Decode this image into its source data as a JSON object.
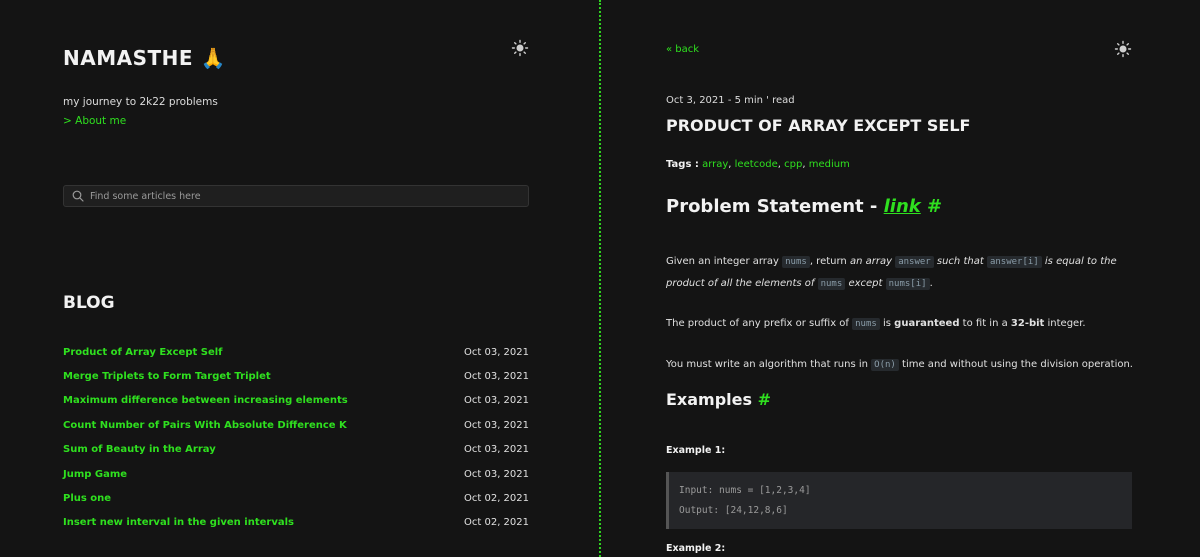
{
  "left": {
    "site_title": "NAMASTHE 🙏",
    "tagline": "my journey to 2k22 problems",
    "about_link": "> About me",
    "search": {
      "placeholder": "Find some articles here"
    },
    "blog_heading": "BLOG",
    "posts": [
      {
        "title": "Product of Array Except Self",
        "date": "Oct 03, 2021"
      },
      {
        "title": "Merge Triplets to Form Target Triplet",
        "date": "Oct 03, 2021"
      },
      {
        "title": "Maximum difference between increasing elements",
        "date": "Oct 03, 2021"
      },
      {
        "title": "Count Number of Pairs With Absolute Difference K",
        "date": "Oct 03, 2021"
      },
      {
        "title": "Sum of Beauty in the Array",
        "date": "Oct 03, 2021"
      },
      {
        "title": "Jump Game",
        "date": "Oct 03, 2021"
      },
      {
        "title": "Plus one",
        "date": "Oct 02, 2021"
      },
      {
        "title": "Insert new interval in the given intervals",
        "date": "Oct 02, 2021"
      }
    ]
  },
  "right": {
    "back": "« back",
    "meta": "Oct 3, 2021 - 5 min ' read",
    "title": "PRODUCT OF ARRAY EXCEPT SELF",
    "tags_label": "Tags :",
    "tags": [
      "array",
      "leetcode",
      "cpp",
      "medium"
    ],
    "problem_heading": "Problem Statement - ",
    "problem_link": "link",
    "hash": "#",
    "p1": {
      "t1": "Given an integer array ",
      "c1": "nums",
      "t2": ", return ",
      "i1": "an array ",
      "c2": "answer",
      "i2": " such that ",
      "c3": "answer[i]",
      "i3": " is equal to the product of all the elements of ",
      "c4": "nums",
      "i4": " except ",
      "c5": "nums[i]",
      "t3": "."
    },
    "p2": {
      "t1": "The product of any prefix or suffix of ",
      "c1": "nums",
      "t2": " is ",
      "b1": "guaranteed",
      "t3": " to fit in a ",
      "b2": "32-bit",
      "t4": " integer."
    },
    "p3": {
      "t1": "You must write an algorithm that runs in ",
      "c1": "O(n)",
      "t2": " time and without using the division operation."
    },
    "examples_heading": "Examples ",
    "example1_label": "Example 1:",
    "example1_input": "Input: nums = [1,2,3,4]",
    "example1_output": "Output: [24,12,8,6]",
    "example2_label": "Example 2:"
  },
  "colors": {
    "accent": "#2fe01f",
    "background": "#141414",
    "text": "#e6e6e6"
  },
  "icons": {
    "theme_toggle": "sun-icon",
    "search": "search-icon"
  }
}
